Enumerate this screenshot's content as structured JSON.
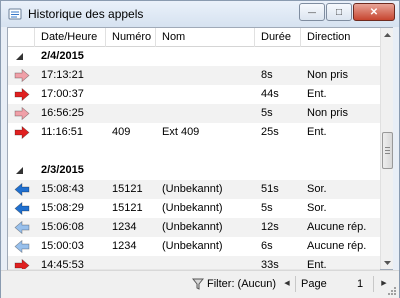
{
  "window": {
    "title": "Historique des appels",
    "minimize_glyph": "—",
    "maximize_glyph": "□",
    "close_glyph": "✕"
  },
  "columns": [
    "Date/Heure",
    "Numéro",
    "Nom",
    "Durée",
    "Direction"
  ],
  "rows": [
    {
      "kind": "group",
      "label": "2/4/2015"
    },
    {
      "kind": "call",
      "icon": "missed-incoming-arrow-icon",
      "color": "#f0a0a8",
      "dir": "right",
      "time": "17:13:21",
      "number": "",
      "name": "",
      "duration": "8s",
      "direction": "Non pris"
    },
    {
      "kind": "call",
      "icon": "incoming-arrow-icon",
      "color": "#e02020",
      "dir": "right",
      "time": "17:00:37",
      "number": "",
      "name": "",
      "duration": "44s",
      "direction": "Ent."
    },
    {
      "kind": "call",
      "icon": "missed-incoming-arrow-icon",
      "color": "#f0a0a8",
      "dir": "right",
      "time": "16:56:25",
      "number": "",
      "name": "",
      "duration": "5s",
      "direction": "Non pris"
    },
    {
      "kind": "call",
      "icon": "incoming-arrow-icon",
      "color": "#e02020",
      "dir": "right",
      "time": "11:16:51",
      "number": "409",
      "name": "Ext 409",
      "duration": "25s",
      "direction": "Ent."
    },
    {
      "kind": "spacer"
    },
    {
      "kind": "group",
      "label": "2/3/2015"
    },
    {
      "kind": "call",
      "icon": "outgoing-arrow-icon",
      "color": "#2070d0",
      "dir": "left",
      "time": "15:08:43",
      "number": "15121",
      "name": "(Unbekannt)",
      "duration": "51s",
      "direction": "Sor."
    },
    {
      "kind": "call",
      "icon": "outgoing-arrow-icon",
      "color": "#2070d0",
      "dir": "left",
      "time": "15:08:29",
      "number": "15121",
      "name": "(Unbekannt)",
      "duration": "5s",
      "direction": "Sor."
    },
    {
      "kind": "call",
      "icon": "unanswered-outgoing-arrow-icon",
      "color": "#98c0ec",
      "dir": "left",
      "time": "15:06:08",
      "number": "1234",
      "name": "(Unbekannt)",
      "duration": "12s",
      "direction": "Aucune rép."
    },
    {
      "kind": "call",
      "icon": "unanswered-outgoing-arrow-icon",
      "color": "#98c0ec",
      "dir": "left",
      "time": "15:00:03",
      "number": "1234",
      "name": "(Unbekannt)",
      "duration": "6s",
      "direction": "Aucune rép."
    },
    {
      "kind": "call",
      "icon": "incoming-arrow-icon",
      "color": "#e02020",
      "dir": "right",
      "time": "14:45:53",
      "number": "",
      "name": "",
      "duration": "33s",
      "direction": "Ent."
    }
  ],
  "statusbar": {
    "filter_label": "Filter: (Aucun)",
    "prev_glyph": "◀",
    "page_label": "Page",
    "page_number": "1",
    "next_glyph": "▶"
  }
}
